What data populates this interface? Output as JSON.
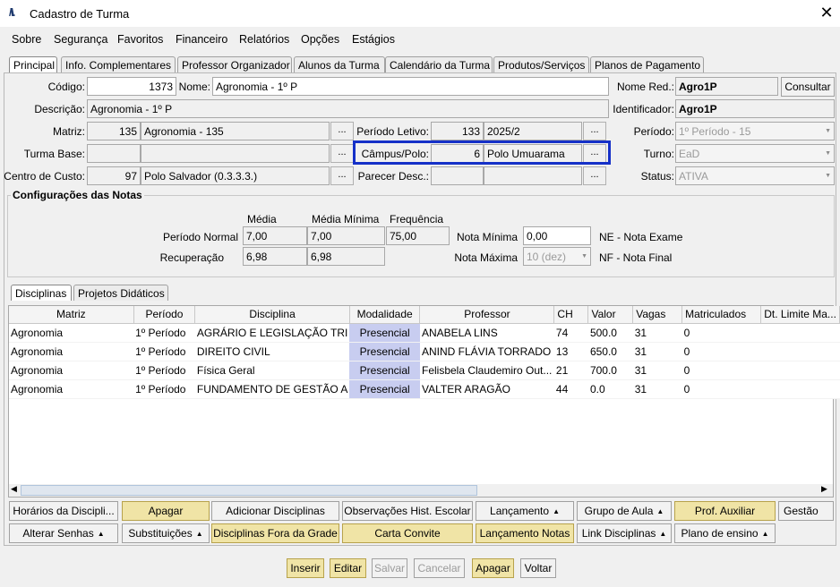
{
  "window": {
    "title": "Cadastro de Turma"
  },
  "menu": [
    "Sobre",
    "Segurança",
    "Favoritos",
    "Financeiro",
    "Relatórios",
    "Opções",
    "Estágios"
  ],
  "tabs": [
    "Principal",
    "Info. Complementares",
    "Professor Organizador",
    "Alunos da Turma",
    "Calendário da Turma",
    "Produtos/Serviços",
    "Planos de Pagamento"
  ],
  "form": {
    "codigo_label": "Código:",
    "codigo": "1373",
    "nome_label": "Nome:",
    "nome": "Agronomia - 1º P",
    "nome_red_label": "Nome Red.:",
    "nome_red": "Agro1P",
    "consultar": "Consultar",
    "descricao_label": "Descrição:",
    "descricao": "Agronomia - 1º P",
    "identificador_label": "Identificador:",
    "identificador": "Agro1P",
    "matriz_label": "Matriz:",
    "matriz_cod": "135",
    "matriz_nome": "Agronomia - 135",
    "periodo_letivo_label": "Período Letivo:",
    "periodo_letivo_cod": "133",
    "periodo_letivo": "2025/2",
    "periodo_label": "Período:",
    "periodo": "1º Período - 15",
    "turma_base_label": "Turma Base:",
    "campus_label": "Câmpus/Polo:",
    "campus_cod": "6",
    "campus": "Polo Umuarama",
    "turno_label": "Turno:",
    "turno": "EaD",
    "centro_custo_label": "Centro de Custo:",
    "centro_custo_cod": "97",
    "centro_custo": "Polo Salvador (0.3.3.3.)",
    "parecer_label": "Parecer Desc.:",
    "status_label": "Status:",
    "status": "ATIVA",
    "dots": "..."
  },
  "notas": {
    "title": "Configurações das Notas",
    "col_media": "Média",
    "col_media_minima": "Média Mínima",
    "col_frequencia": "Frequência",
    "periodo_normal_label": "Período Normal",
    "pn_media": "7,00",
    "pn_media_minima": "7,00",
    "pn_frequencia": "75,00",
    "recuperacao_label": "Recuperação",
    "rec_media": "6,98",
    "rec_media_minima": "6,98",
    "nota_minima_label": "Nota Mínima",
    "nota_minima": "0,00",
    "nota_maxima_label": "Nota Máxima",
    "nota_maxima": "10 (dez)",
    "ne": "NE - Nota Exame",
    "nf": "NF - Nota Final"
  },
  "subtabs": [
    "Disciplinas",
    "Projetos Didáticos"
  ],
  "grid": {
    "columns": [
      "Matriz",
      "Período",
      "Disciplina",
      "Modalidade",
      "Professor",
      "CH",
      "Valor",
      "Vagas",
      "Matriculados",
      "Dt. Limite Ma..."
    ],
    "rows": [
      [
        "Agronomia",
        "1º Período",
        "AGRÁRIO E LEGISLAÇÃO TRI",
        "Presencial",
        "ANABELA LINS",
        "74",
        "500.0",
        "31",
        "0",
        ""
      ],
      [
        "Agronomia",
        "1º Período",
        "DIREITO CIVIL",
        "Presencial",
        "ANIND FLÁVIA TORRADO",
        "13",
        "650.0",
        "31",
        "0",
        ""
      ],
      [
        "Agronomia",
        "1º Período",
        "Física Geral",
        "Presencial",
        "Felisbela Claudemiro Out...",
        "21",
        "700.0",
        "31",
        "0",
        ""
      ],
      [
        "Agronomia",
        "1º Período",
        "FUNDAMENTO DE GESTÃO A",
        "Presencial",
        "VALTER ARAGÃO",
        "44",
        "0.0",
        "31",
        "0",
        ""
      ]
    ]
  },
  "actions_row1": [
    "Horários da Discipli...",
    "Apagar",
    "Adicionar Disciplinas",
    "Observações Hist. Escolar",
    "Lançamento",
    "Grupo de Aula",
    "Prof. Auxiliar",
    "Gestão"
  ],
  "actions_row2": [
    "Alterar Senhas",
    "Substituições",
    "Disciplinas Fora da Grade",
    "Carta Convite",
    "Lançamento Notas",
    "Link Disciplinas",
    "Plano de ensino"
  ],
  "footer": [
    "Inserir",
    "Editar",
    "Salvar",
    "Cancelar",
    "Apagar",
    "Voltar"
  ],
  "colors": {
    "highlight": "#1530c8",
    "modalidade_bg": "#c8cdf0",
    "yellow_button": "#f0e4a6"
  }
}
